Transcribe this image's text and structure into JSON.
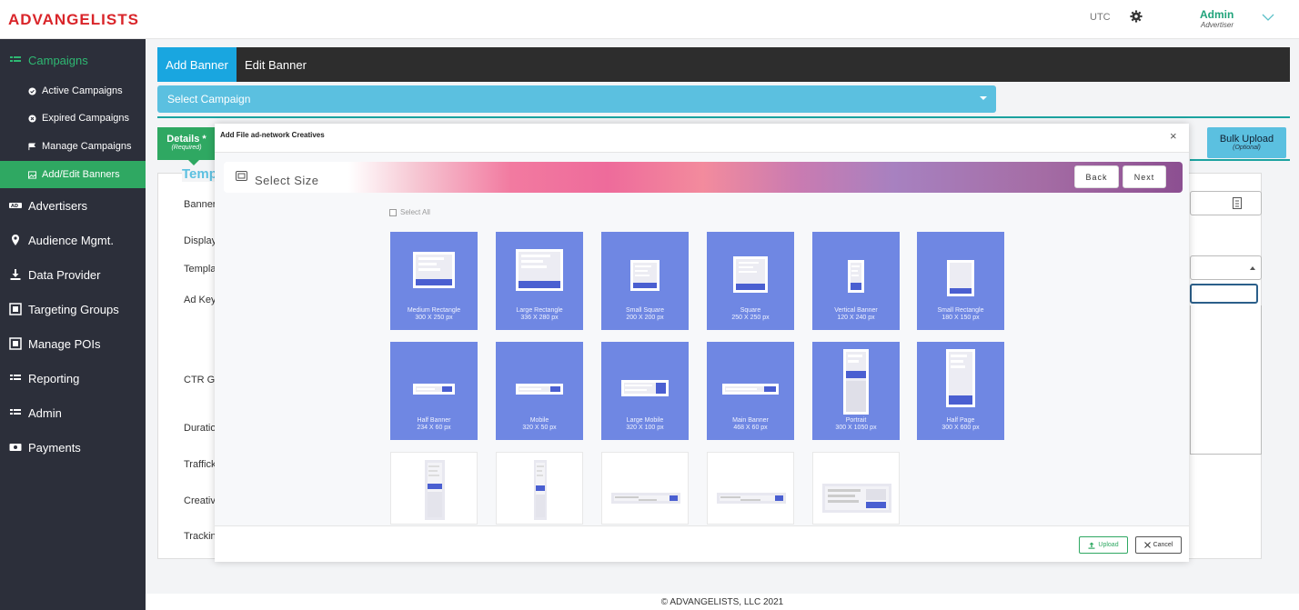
{
  "app": {
    "logo": "ADVANGELISTS"
  },
  "header": {
    "timezone": "UTC",
    "user_name": "Admin",
    "user_role": "Advertiser"
  },
  "sidebar": {
    "campaigns": "Campaigns",
    "sub": [
      "Active Campaigns",
      "Expired Campaigns",
      "Manage Campaigns",
      "Add/Edit Banners"
    ],
    "items": [
      "Advertisers",
      "Audience Mgmt.",
      "Data Provider",
      "Targeting Groups",
      "Manage POIs",
      "Reporting",
      "Admin",
      "Payments"
    ]
  },
  "main": {
    "tab_add": "Add Banner",
    "tab_edit": "Edit Banner",
    "select_campaign": "Select Campaign",
    "details_tab": "Details *",
    "details_sub": "(Required)",
    "bulk_upload": "Bulk Upload",
    "bulk_sub": "(Optional)",
    "form_title": "Temp",
    "labels": [
      "Banner",
      "Display",
      "Templa",
      "Ad Key",
      "CTR Go",
      "Duratio",
      "Traffick",
      "Creativ",
      "Trackin"
    ]
  },
  "modal": {
    "title": "Add File ad-network Creatives",
    "close": "×",
    "select_size": "Select Size",
    "back": "Back",
    "next": "Next",
    "select_all": "Select All",
    "upload": "Upload",
    "cancel": "Cancel",
    "sizes": [
      {
        "name": "Medium Rectangle",
        "dims": "300 X 250 px"
      },
      {
        "name": "Large Rectangle",
        "dims": "336 X 280 px"
      },
      {
        "name": "Small Square",
        "dims": "200 X 200 px"
      },
      {
        "name": "Square",
        "dims": "250 X 250 px"
      },
      {
        "name": "Vertical Banner",
        "dims": "120 X 240 px"
      },
      {
        "name": "Small Rectangle",
        "dims": "180 X 150 px"
      },
      {
        "name": "Half Banner",
        "dims": "234 X 60 px"
      },
      {
        "name": "Mobile",
        "dims": "320 X 50 px"
      },
      {
        "name": "Large Mobile",
        "dims": "320 X 100 px"
      },
      {
        "name": "Main Banner",
        "dims": "468 X 60 px"
      },
      {
        "name": "Portrait",
        "dims": "300 X 1050 px"
      },
      {
        "name": "Half Page",
        "dims": "300 X 600 px"
      }
    ]
  },
  "footer": {
    "copyright": "© ADVANGELISTS, LLC 2021"
  },
  "colors": {
    "brand_red": "#d9252a",
    "sidebar_bg": "#2c2f3a",
    "accent_green": "#2fa862",
    "accent_blue": "#19a6e0",
    "card_blue": "#6f87e3"
  }
}
